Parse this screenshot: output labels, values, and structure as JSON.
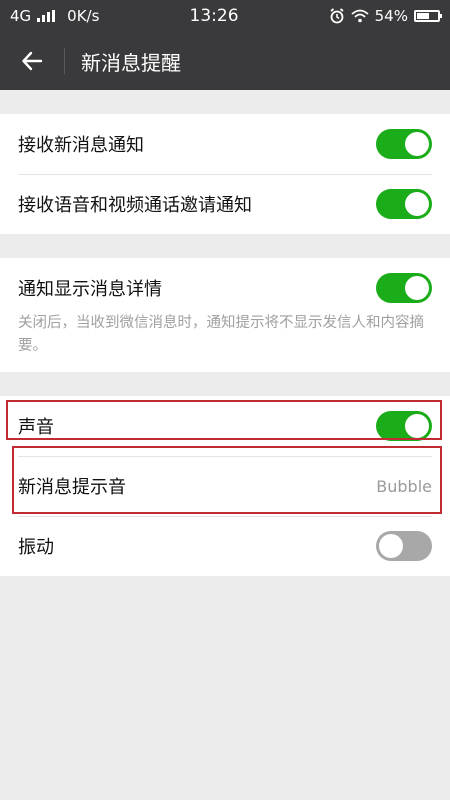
{
  "status_bar": {
    "network": "4G",
    "speed": "0K/s",
    "time": "13:26",
    "battery": "54%",
    "battery_level": 0.54
  },
  "header": {
    "title": "新消息提醒",
    "back_icon": "arrow-left-icon"
  },
  "sections": [
    {
      "rows": [
        {
          "label": "接收新消息通知",
          "toggle": true
        },
        {
          "label": "接收语音和视频通话邀请通知",
          "toggle": true
        }
      ]
    },
    {
      "rows": [
        {
          "label": "通知显示消息详情",
          "toggle": true
        }
      ],
      "description": "关闭后，当收到微信消息时，通知提示将不显示发信人和内容摘要。"
    },
    {
      "rows": [
        {
          "label": "声音",
          "toggle": true
        },
        {
          "label": "新消息提示音",
          "value": "Bubble"
        },
        {
          "label": "振动",
          "toggle": false
        }
      ]
    }
  ],
  "colors": {
    "toggle_on": "#1aad19",
    "toggle_off": "#a8a8a8",
    "highlight": "#c22b34",
    "header_bg": "#3a3a3c"
  }
}
